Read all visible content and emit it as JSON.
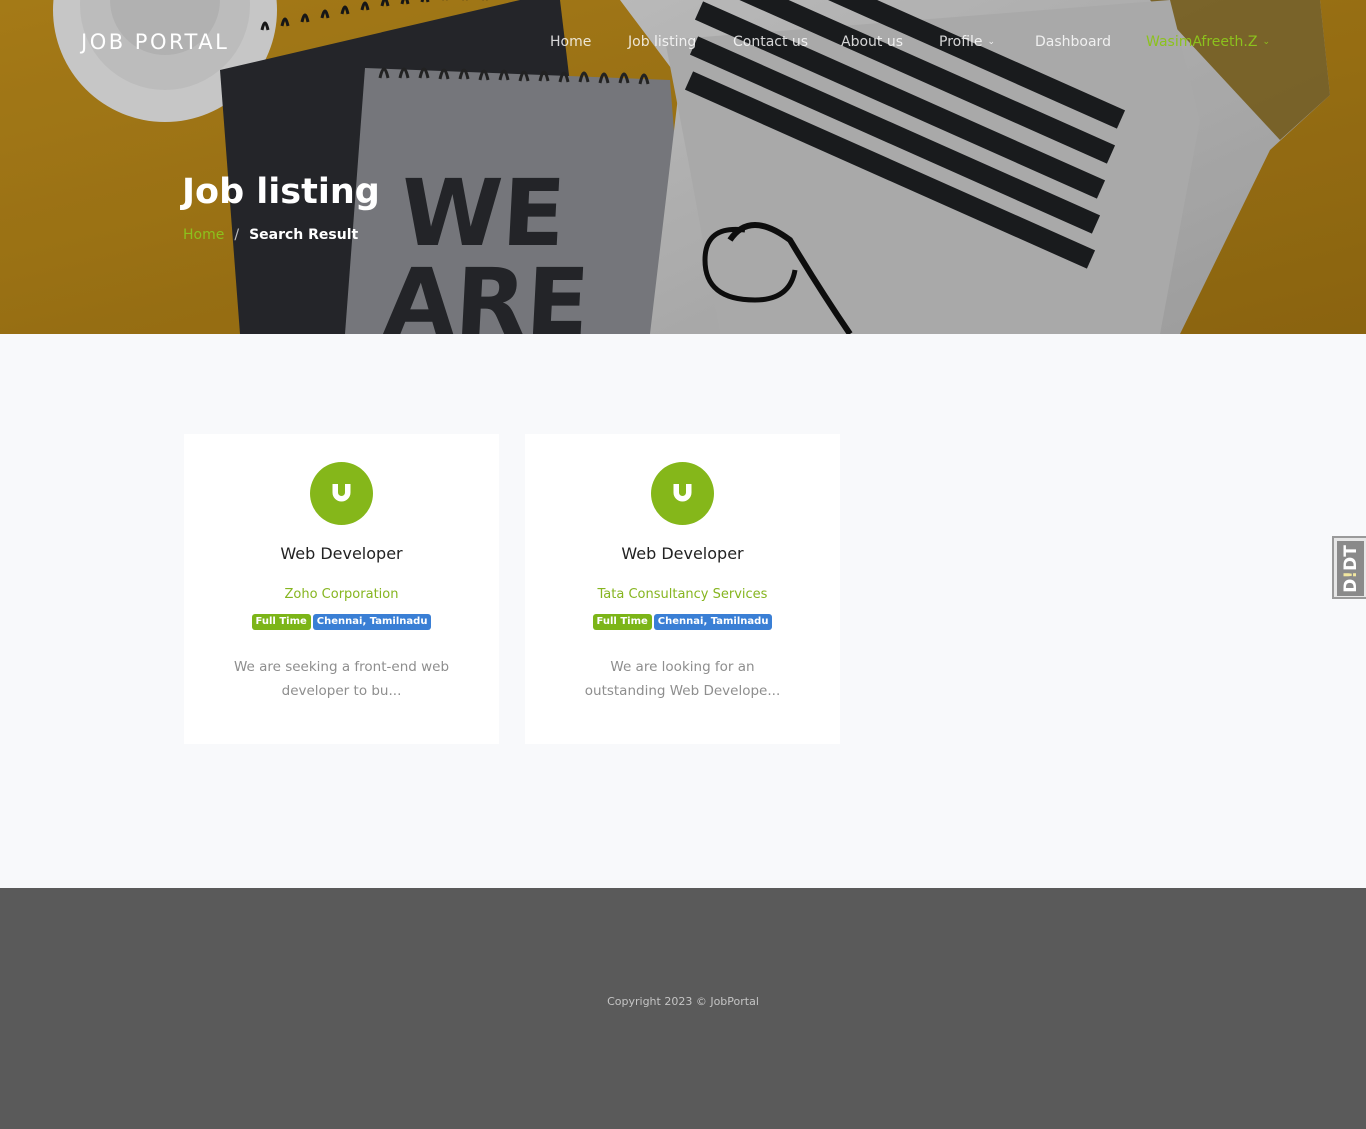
{
  "brand": "JOB PORTAL",
  "nav": {
    "items": [
      {
        "label": "Home"
      },
      {
        "label": "Job listing"
      },
      {
        "label": "Contact us"
      },
      {
        "label": "About us"
      },
      {
        "label": "Profile"
      },
      {
        "label": "Dashboard"
      },
      {
        "label": "WasimAfreeth.Z"
      }
    ]
  },
  "hero": {
    "title": "Job listing",
    "breadcrumb": {
      "home": "Home",
      "separator": "/",
      "current": "Search Result"
    }
  },
  "jobs": [
    {
      "title": "Web Developer",
      "company": "Zoho Corporation",
      "type": "Full Time",
      "location": "Chennai, Tamilnadu",
      "description": "We are seeking a front-end web developer to bu..."
    },
    {
      "title": "Web Developer",
      "company": "Tata Consultancy Services",
      "type": "Full Time",
      "location": "Chennai, Tamilnadu",
      "description": "We are looking for an outstanding Web Develope..."
    }
  ],
  "side_tab": {
    "prefix": "D",
    "mark": "!",
    "suffix": "DT"
  },
  "footer": {
    "copyright": "Copyright 2023 © JobPortal"
  },
  "colors": {
    "accent": "#8cc21d",
    "logo_bg": "#85b71a",
    "badge_location": "#3a7fd5",
    "footer_bg": "#5a5a5a"
  },
  "icons": {
    "company_logo": "u-magnet-icon",
    "dropdown": "chevron-down-icon"
  }
}
